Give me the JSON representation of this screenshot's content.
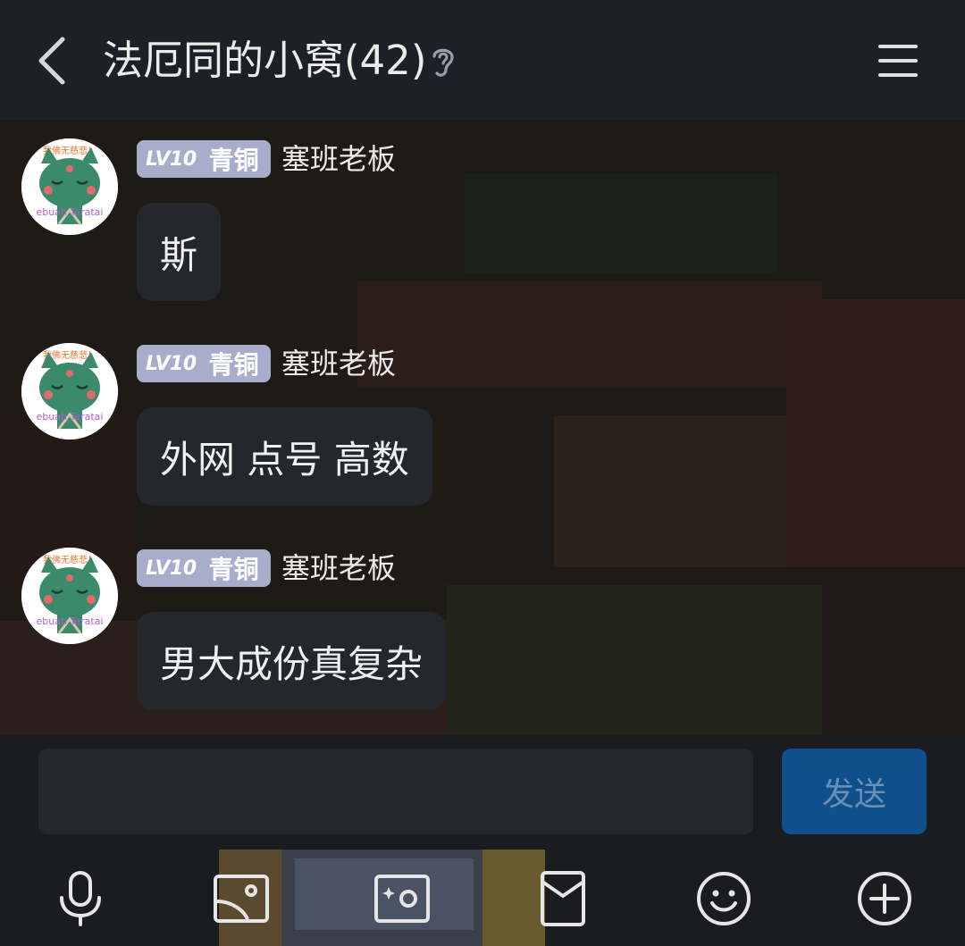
{
  "header": {
    "title": "法厄同的小窝(42)",
    "back_icon": "chevron-left-icon",
    "ear_icon": "ear-icon",
    "menu_icon": "hamburger-menu-icon"
  },
  "messages": [
    {
      "level": "LV10",
      "tier": "青铜",
      "sender": "塞班老板",
      "text": "斯"
    },
    {
      "level": "LV10",
      "tier": "青铜",
      "sender": "塞班老板",
      "text": "外网 点号 高数"
    },
    {
      "level": "LV10",
      "tier": "青铜",
      "sender": "塞班老板",
      "text": "男大成份真复杂"
    }
  ],
  "avatar": {
    "top_text": "我佛无慈悲！",
    "bottom_text": "ebuah Teratai"
  },
  "composer": {
    "input_value": "",
    "send_label": "发送"
  },
  "toolbar": {
    "items": [
      "microphone-icon",
      "image-icon",
      "camera-icon",
      "red-packet-icon",
      "emoji-icon",
      "plus-icon"
    ]
  },
  "colors": {
    "header_bg": "#1d2026",
    "bubble_bg": "#24272c",
    "badge_bg": "#a9adcc",
    "send_bg": "#0e4f8c",
    "send_text": "#6b8fb2"
  }
}
